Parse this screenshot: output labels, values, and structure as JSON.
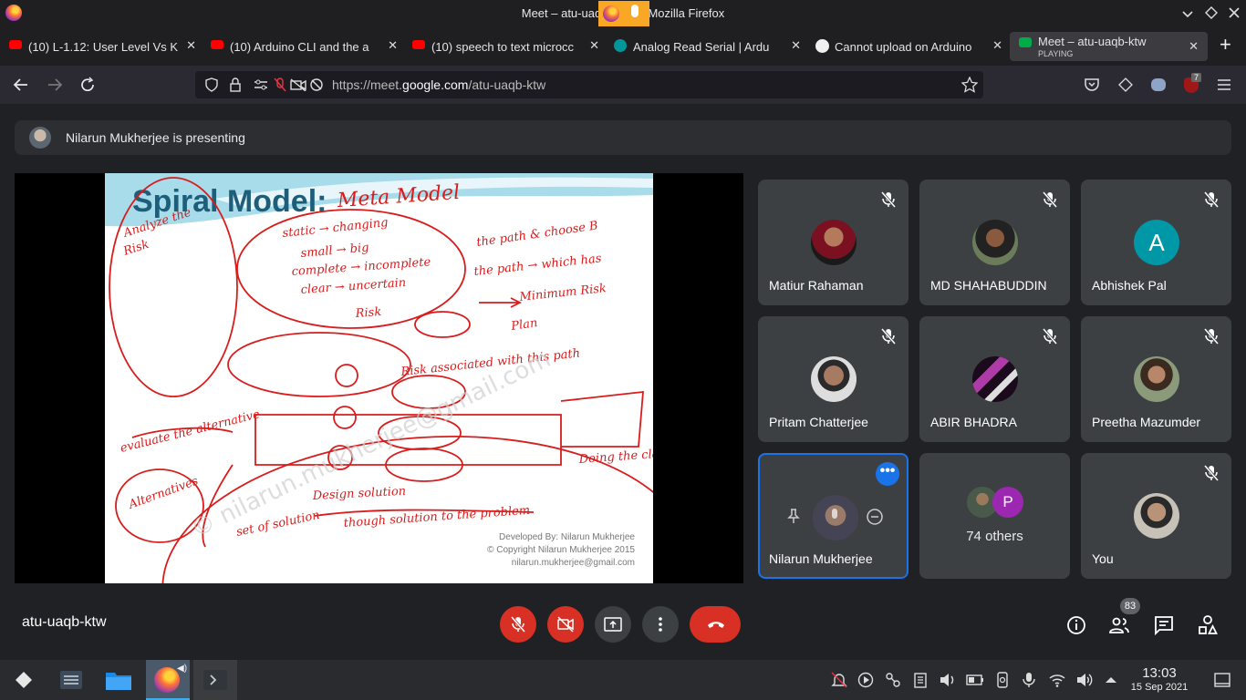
{
  "window": {
    "title": "Meet – atu-uaqb-ktw — Mozilla Firefox"
  },
  "tabs": [
    {
      "label": "(10) L-1.12: User Level Vs K",
      "icon": "youtube-icon"
    },
    {
      "label": "(10) Arduino CLI and the a",
      "icon": "youtube-icon"
    },
    {
      "label": "(10) speech to text microcc",
      "icon": "youtube-icon"
    },
    {
      "label": "Analog Read Serial | Ardu",
      "icon": "arduino-icon"
    },
    {
      "label": "Cannot upload on Arduino",
      "icon": "github-icon"
    },
    {
      "label": "Meet – atu-uaqb-ktw",
      "sub": "PLAYING",
      "icon": "meet-icon"
    }
  ],
  "navbar": {
    "url_prefix": "https://meet.",
    "url_domain": "google.com",
    "url_suffix": "/atu-uaqb-ktw",
    "extension_badge": "7"
  },
  "presenting": {
    "text": "Nilarun Mukherjee is presenting"
  },
  "slide": {
    "title": "Spiral Model:",
    "handwritten_title": "Meta Model",
    "notes": [
      "Analyze the",
      "Risk",
      "static → changing",
      "small → big",
      "complete → incomplete",
      "clear → uncertain",
      "the path & choose B",
      "the path → which has",
      "Minimum Risk",
      "Plan",
      "Risk",
      "Risk associated with this path",
      "evaluate the alternative",
      "Alternatives",
      "Design solution",
      "though solution to the problem",
      "Doing the class",
      "set of solution"
    ],
    "credit1": "Developed By: Nilarun Mukherjee",
    "credit2": "© Copyright Nilarun Mukherjee 2015",
    "credit3": "nilarun.mukherjee@gmail.com",
    "watermark": "© nilarun.mukherjee@gmail.com"
  },
  "participants": [
    {
      "name": "Matiur Rahaman"
    },
    {
      "name": "MD SHAHABUDDIN"
    },
    {
      "name": "Abhishek Pal",
      "letter": "A"
    },
    {
      "name": "Pritam Chatterjee"
    },
    {
      "name": "ABIR BHADRA"
    },
    {
      "name": "Preetha Mazumder"
    },
    {
      "name": "Nilarun Mukherjee"
    },
    {
      "name": "74 others",
      "letter": "P"
    },
    {
      "name": "You"
    }
  ],
  "meeting": {
    "id": "atu-uaqb-ktw",
    "people_count": "83"
  },
  "taskbar": {
    "time": "13:03",
    "date": "15 Sep 2021"
  },
  "colors": {
    "bg": "#202124",
    "tile": "#3c4043",
    "red": "#d93025",
    "accent": "#1a73e8",
    "ink": "#d91c1c"
  }
}
